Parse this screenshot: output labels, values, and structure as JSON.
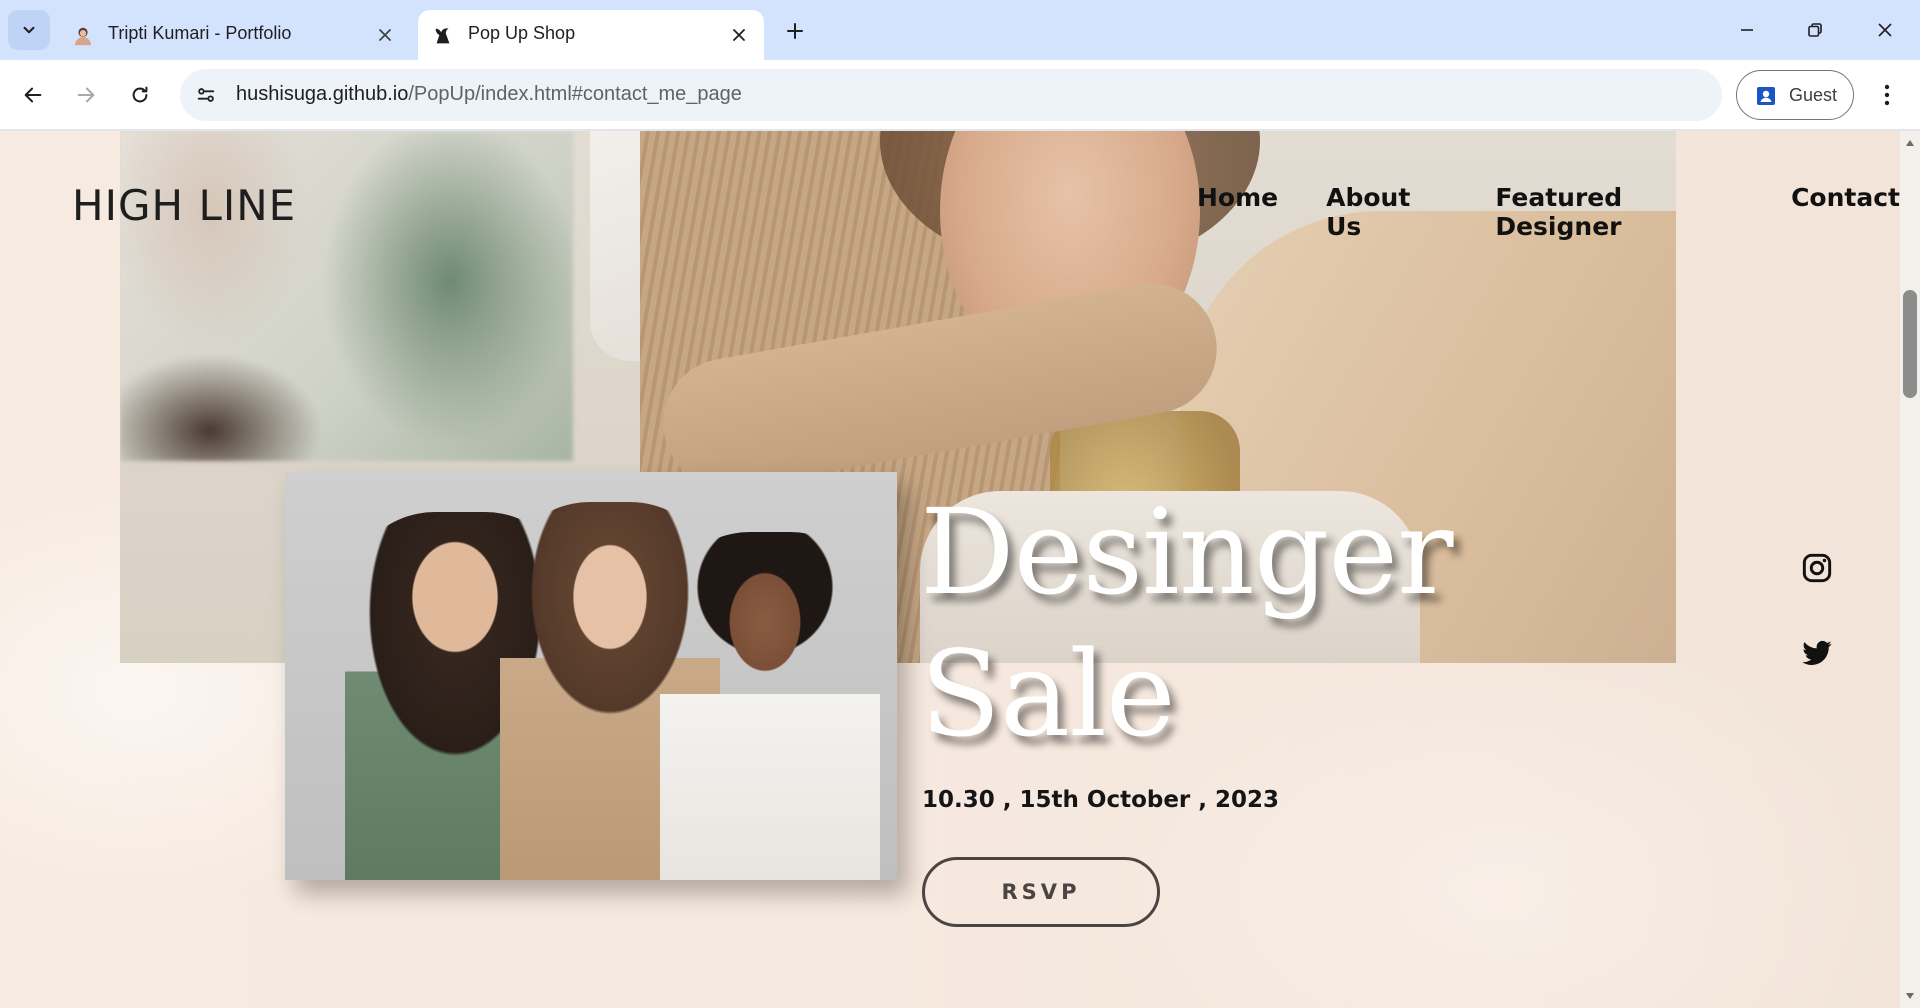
{
  "browser": {
    "tabs": [
      {
        "title": "Tripti Kumari - Portfolio",
        "favicon": "portrait-favicon",
        "active": false
      },
      {
        "title": "Pop Up Shop",
        "favicon": "shop-favicon",
        "active": true
      }
    ],
    "url": {
      "host": "hushisuga.github.io",
      "path": "/PopUp/index.html#contact_me_page"
    },
    "profile_label": "Guest"
  },
  "page": {
    "brand": "HIGH LINE",
    "nav": [
      "Home",
      "About Us",
      "Featured Designer",
      "Contact"
    ],
    "headline_line1": "Desinger",
    "headline_line2": "Sale",
    "event_date": "10.30 , 15th October , 2023",
    "rsvp_label": "RSVP",
    "social": [
      "instagram-icon",
      "twitter-icon"
    ]
  },
  "colors": {
    "tabstrip": "#d3e3fd",
    "page_bg": "#f6e9df",
    "headline_text": "#ffffff",
    "button_border": "#4a4443"
  }
}
